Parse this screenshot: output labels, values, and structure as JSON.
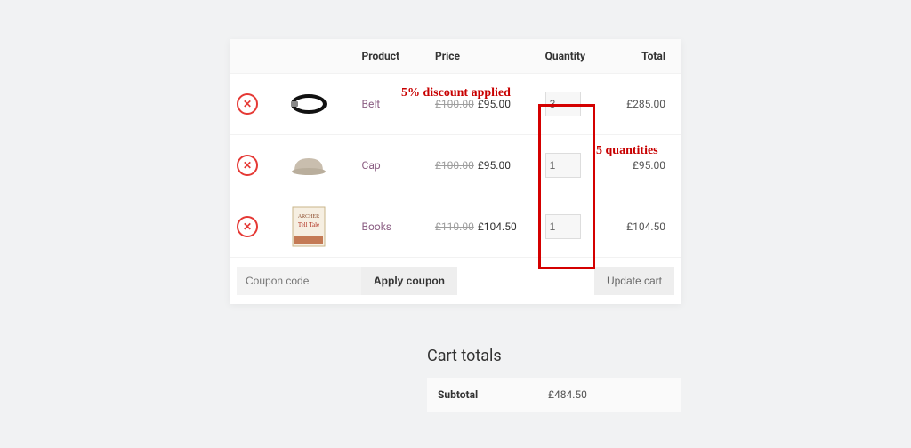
{
  "headers": {
    "product": "Product",
    "price": "Price",
    "quantity": "Quantity",
    "total": "Total"
  },
  "annotations": {
    "discount": "5% discount applied",
    "quantities": "5 quantities"
  },
  "items": [
    {
      "name": "Belt",
      "old_price": "£100.00",
      "new_price": "£95.00",
      "qty": "3",
      "total": "£285.00"
    },
    {
      "name": "Cap",
      "old_price": "£100.00",
      "new_price": "£95.00",
      "qty": "1",
      "total": "£95.00"
    },
    {
      "name": "Books",
      "old_price": "£110.00",
      "new_price": "£104.50",
      "qty": "1",
      "total": "£104.50"
    }
  ],
  "coupon_placeholder": "Coupon code",
  "apply_coupon_label": "Apply coupon",
  "update_cart_label": "Update cart",
  "cart_totals_title": "Cart totals",
  "subtotal_label": "Subtotal",
  "subtotal_value": "£484.50"
}
